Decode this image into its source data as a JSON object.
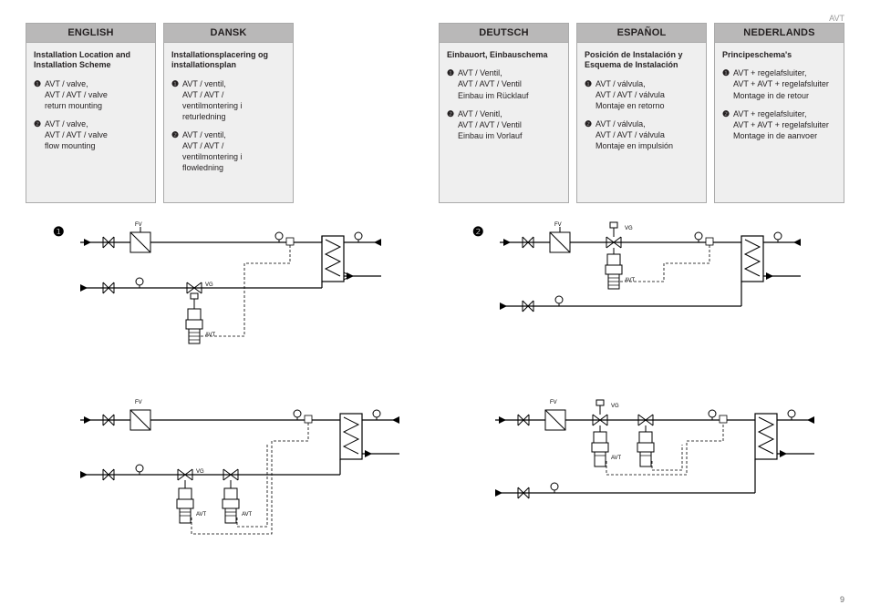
{
  "header_code": "AVT",
  "page_number": "9",
  "diagram_markers": {
    "one": "❶",
    "two": "❷"
  },
  "diagram_labels": {
    "fv": "FV",
    "vg": "VG",
    "avt": "AVT"
  },
  "columns": {
    "english": {
      "header": "ENGLISH",
      "title": "Installation Location and Installation Scheme",
      "item1_num": "❶",
      "item1_txt": "AVT / valve,\nAVT / AVT / valve\nreturn mounting",
      "item2_num": "❷",
      "item2_txt": "AVT / valve,\nAVT / AVT / valve\nflow mounting"
    },
    "dansk": {
      "header": "DANSK",
      "title": "Installationsplacering og installationsplan",
      "item1_num": "❶",
      "item1_txt": "AVT / ventil,\nAVT / AVT /\nventilmontering i\nreturledning",
      "item2_num": "❷",
      "item2_txt": "AVT / ventil,\nAVT / AVT /\nventilmontering i\nflowledning"
    },
    "deutsch": {
      "header": "DEUTSCH",
      "title": "Einbauort, Einbauschema",
      "item1_num": "❶",
      "item1_txt": "AVT / Ventil,\nAVT / AVT / Ventil\nEinbau im Rücklauf",
      "item2_num": "❷",
      "item2_txt": "AVT / Venitl,\nAVT / AVT / Ventil\nEinbau im Vorlauf"
    },
    "espanol": {
      "header": "ESPAÑOL",
      "title": "Posición de Instalación y Esquema de Instalación",
      "item1_num": "❶",
      "item1_txt": "AVT / válvula,\nAVT / AVT / válvula\nMontaje en retorno",
      "item2_num": "❷",
      "item2_txt": "AVT / válvula,\nAVT / AVT / válvula\nMontaje en impulsión"
    },
    "nederlands": {
      "header": "NEDERLANDS",
      "title": "Principeschema's",
      "item1_num": "❶",
      "item1_txt": "AVT + regelafsluiter,\nAVT  + AVT + regelafsluiter\nMontage in de retour",
      "item2_num": "❷",
      "item2_txt": "AVT + regelafsluiter,\nAVT  + AVT + regelafsluiter\nMontage in de aanvoer"
    }
  }
}
